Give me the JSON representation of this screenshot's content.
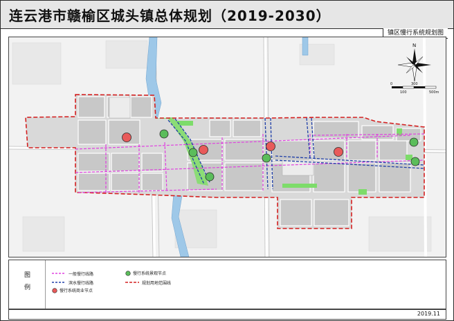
{
  "title": "连云港市赣榆区城头镇总体规划（2019-2030）",
  "subtitle": "镇区慢行系统规划图",
  "legend": {
    "heading_top": "图",
    "heading_bottom": "例",
    "items": [
      {
        "label": "一般慢行线路",
        "kind": "line-magenta"
      },
      {
        "label": "慢行系统景观节点",
        "kind": "node-green"
      },
      {
        "label": "滨水慢行线路",
        "kind": "line-blue"
      },
      {
        "label": "规划用地范围线",
        "kind": "line-red"
      },
      {
        "label": "慢行系统商业节点",
        "kind": "node-red"
      }
    ]
  },
  "scale_bar": {
    "ticks": [
      "0",
      "100",
      "300",
      "500m"
    ]
  },
  "north_arrow": {
    "label": "N"
  },
  "date": "2019.11",
  "colors": {
    "general_route": "#e040e0",
    "waterfront_route": "#1f3fa8",
    "boundary": "#d41f1f",
    "landscape_node": "#3aa33a",
    "commercial_node": "#e03a3a",
    "water": "#9ec8e8",
    "green": "#7ddc6a"
  }
}
